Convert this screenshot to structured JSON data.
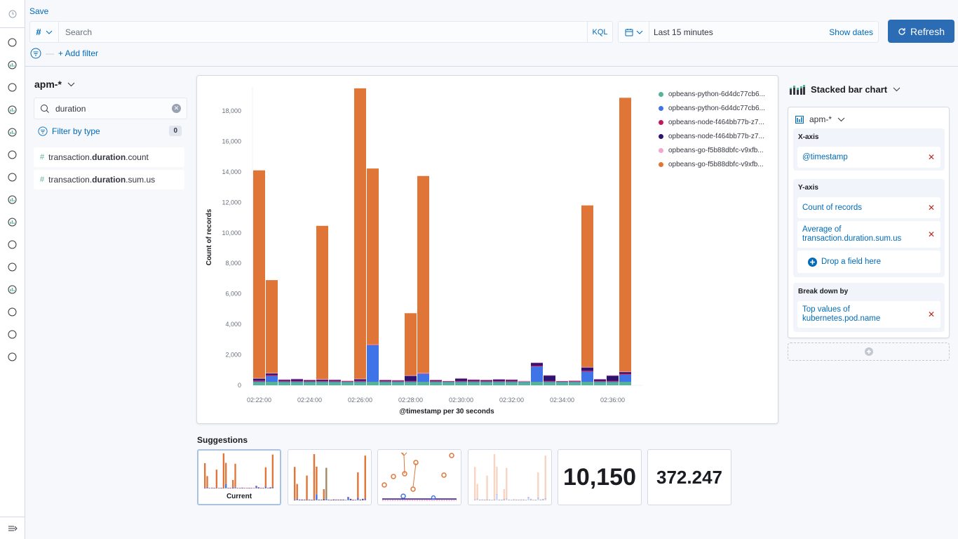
{
  "topbar": {
    "save_label": "Save",
    "query_language_symbol": "#",
    "search_placeholder": "Search",
    "kql_label": "KQL",
    "time_range": "Last 15 minutes",
    "show_dates_label": "Show dates",
    "refresh_label": "Refresh",
    "add_filter_label": "+ Add filter"
  },
  "nav": {
    "icons": [
      "recently-viewed-icon",
      "discover-icon",
      "visualize-icon",
      "dashboard-icon",
      "canvas-icon",
      "maps-icon",
      "ml-icon",
      "metrics-icon",
      "logs-icon",
      "apm-icon",
      "uptime-icon",
      "siem-icon",
      "graph-icon",
      "dev-tools-icon",
      "monitoring-icon",
      "management-icon"
    ],
    "collapse_icon": "dock-navigation-icon"
  },
  "field_panel": {
    "index_pattern": "apm-*",
    "search_value": "duration",
    "filter_by_type_label": "Filter by type",
    "filter_count": "0",
    "fields": [
      {
        "prefix": "transaction.",
        "match": "duration",
        "suffix": ".count"
      },
      {
        "prefix": "transaction.",
        "match": "duration",
        "suffix": ".sum.us"
      }
    ]
  },
  "config_panel": {
    "visualization_type": "Stacked bar chart",
    "layer_index": "apm-*",
    "x_axis_title": "X-axis",
    "x_axis_value": "@timestamp",
    "y_axis_title": "Y-axis",
    "y_axis_values": [
      "Count of records",
      "Average of transaction.duration.sum.us"
    ],
    "drop_field_label": "Drop a field here",
    "breakdown_title": "Break down by",
    "breakdown_value": "Top values of kubernetes.pod.name"
  },
  "suggestions": {
    "title": "Suggestions",
    "current_label": "Current",
    "metric_1": "10,150",
    "metric_2": "372.247"
  },
  "chart_data": {
    "type": "bar",
    "stacked": true,
    "title": "",
    "xlabel": "@timestamp per 30 seconds",
    "ylabel": "Count of records",
    "ylim": [
      0,
      19500
    ],
    "yticks": [
      0,
      2000,
      4000,
      6000,
      8000,
      10000,
      12000,
      14000,
      16000,
      18000
    ],
    "ytick_labels": [
      "0",
      "2,000",
      "4,000",
      "6,000",
      "8,000",
      "10,000",
      "12,000",
      "14,000",
      "16,000",
      "18,000"
    ],
    "xtick_labels": [
      "02:22:00",
      "02:24:00",
      "02:26:00",
      "02:28:00",
      "02:30:00",
      "02:32:00",
      "02:34:00",
      "02:36:00"
    ],
    "categories": [
      "02:22:00",
      "02:22:30",
      "02:23:00",
      "02:23:30",
      "02:24:00",
      "02:24:30",
      "02:25:00",
      "02:25:30",
      "02:26:00",
      "02:26:30",
      "02:27:00",
      "02:27:30",
      "02:28:00",
      "02:28:30",
      "02:29:00",
      "02:29:30",
      "02:30:00",
      "02:30:30",
      "02:31:00",
      "02:31:30",
      "02:32:00",
      "02:32:30",
      "02:33:00",
      "02:33:30",
      "02:34:00",
      "02:34:30",
      "02:35:00",
      "02:35:30",
      "02:36:00",
      "02:36:30"
    ],
    "legend_position": "top-right",
    "series": [
      {
        "name": "opbeans-python-6d4dc77cb6...",
        "color": "#54b399",
        "values": [
          230,
          230,
          230,
          230,
          230,
          230,
          230,
          230,
          230,
          230,
          230,
          230,
          230,
          230,
          230,
          230,
          230,
          230,
          230,
          230,
          230,
          230,
          230,
          230,
          230,
          230,
          230,
          230,
          230,
          230
        ]
      },
      {
        "name": "opbeans-python-6d4dc77cb6...",
        "color": "#3f74e8",
        "values": [
          20,
          380,
          10,
          10,
          10,
          10,
          10,
          10,
          10,
          2400,
          10,
          10,
          10,
          520,
          10,
          10,
          10,
          10,
          10,
          10,
          10,
          10,
          1000,
          10,
          10,
          10,
          670,
          10,
          10,
          470
        ]
      },
      {
        "name": "opbeans-node-f464bb77b-z7...",
        "color": "#c2185b",
        "values": [
          60,
          60,
          40,
          40,
          40,
          40,
          40,
          50,
          50,
          30,
          40,
          40,
          40,
          40,
          40,
          40,
          40,
          40,
          40,
          40,
          40,
          40,
          60,
          40,
          40,
          40,
          60,
          40,
          40,
          60
        ]
      },
      {
        "name": "opbeans-node-f464bb77b-z7...",
        "color": "#2e1470",
        "values": [
          140,
          120,
          100,
          140,
          80,
          110,
          90,
          0,
          120,
          0,
          80,
          60,
          360,
          0,
          80,
          0,
          180,
          100,
          80,
          120,
          100,
          0,
          190,
          380,
          0,
          30,
          220,
          130,
          360,
          120
        ]
      },
      {
        "name": "opbeans-go-f5b88dbfc-v9xfb...",
        "color": "#f4a6cf",
        "values": [
          20,
          20,
          10,
          10,
          10,
          10,
          10,
          0,
          20,
          20,
          10,
          10,
          10,
          20,
          10,
          0,
          10,
          10,
          10,
          10,
          10,
          10,
          20,
          10,
          0,
          10,
          20,
          10,
          20,
          20
        ]
      },
      {
        "name": "opbeans-go-f5b88dbfc-v9xfb...",
        "color": "#e07538",
        "values": [
          13630,
          6090,
          0,
          0,
          0,
          10060,
          0,
          0,
          19050,
          11540,
          0,
          0,
          4080,
          12920,
          0,
          0,
          0,
          0,
          0,
          0,
          0,
          0,
          0,
          0,
          0,
          0,
          10600,
          0,
          0,
          17960
        ]
      }
    ]
  }
}
